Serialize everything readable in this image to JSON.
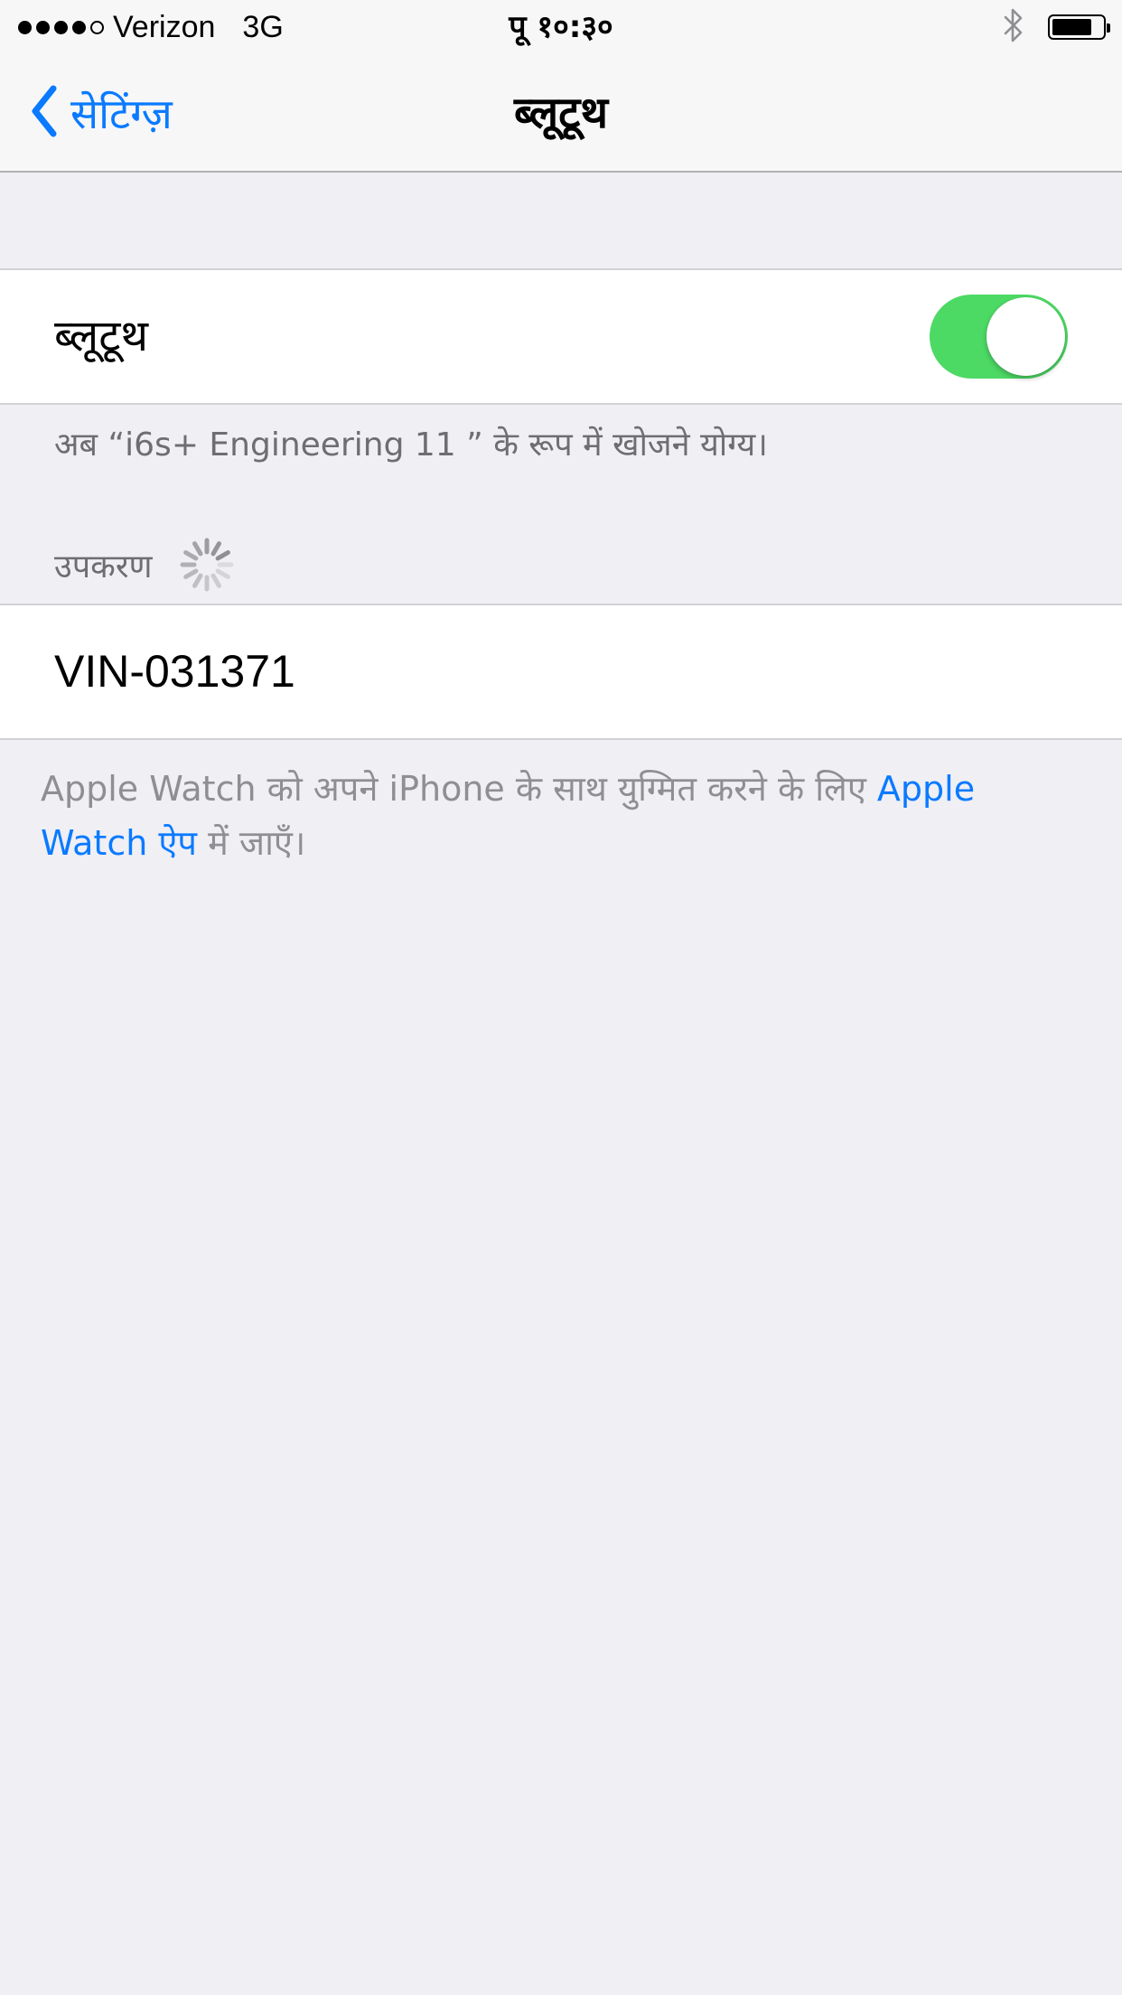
{
  "status_bar": {
    "carrier": "Verizon",
    "network": "3G",
    "time": "पू १०:३०",
    "signal_bars_filled": 4,
    "signal_bars_total": 5,
    "battery_level": 0.8,
    "icons": [
      "signal-dots",
      "bluetooth-icon",
      "battery-icon"
    ]
  },
  "nav": {
    "back_label": "सेटिंग्ज़",
    "title": "ब्लूटूथ",
    "back_icon": "chevron-left-icon"
  },
  "bluetooth_cell": {
    "label": "ब्लूटूथ",
    "toggle_on": true
  },
  "discoverable_text": "अब “i6s+ Engineering 11 ” के रूप में खोजने योग्य।",
  "devices_section": {
    "header": "उपकरण",
    "spinner_icon": "activity-spinner-icon"
  },
  "devices": [
    {
      "name": "VIN-031371"
    }
  ],
  "footer": {
    "text_before": "Apple Watch को अपने iPhone के साथ युग्मित करने के लिए ",
    "link_text": "Apple Watch ऐप",
    "text_after": " में जाएँ।"
  },
  "colors": {
    "accent": "#0a7aff",
    "toggle_on": "#4cd964",
    "background": "#efeff4",
    "secondary_text": "#6d6d72"
  }
}
